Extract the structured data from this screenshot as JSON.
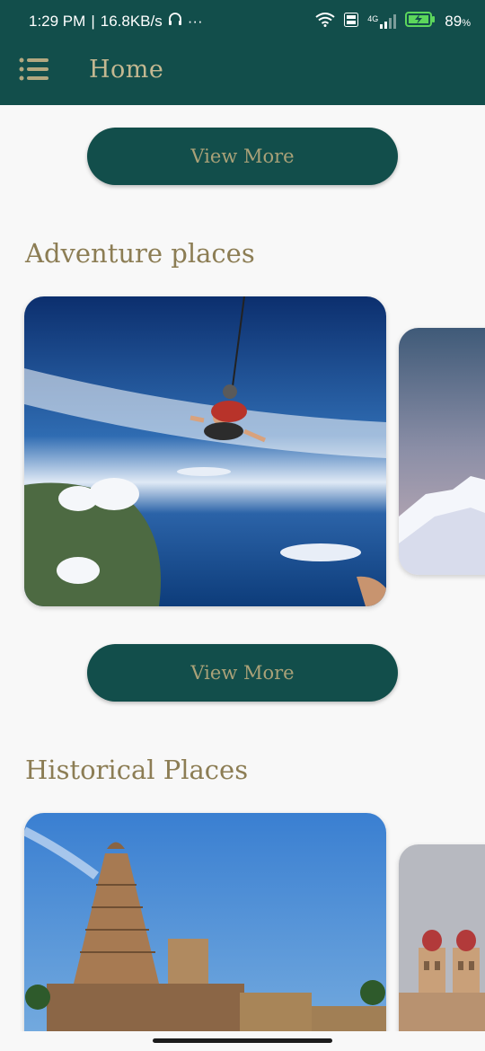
{
  "status_bar": {
    "time": "1:29 PM",
    "separator": "|",
    "speed": "16.8KB/s",
    "more": "···",
    "network": "4G",
    "battery_percent": "89",
    "battery_unit": "%"
  },
  "app_bar": {
    "title": "Home",
    "menu_icon": "menu-list-icon"
  },
  "buttons": {
    "view_more_1": "View More",
    "view_more_2": "View More"
  },
  "sections": {
    "adventure": {
      "title": "Adventure places"
    },
    "historical": {
      "title": "Historical Places"
    }
  },
  "colors": {
    "primary": "#124e4b",
    "title_gold": "#c4b891",
    "button_text": "#a9a178",
    "section_title": "#8c7d54",
    "background": "#f8f8f8"
  }
}
